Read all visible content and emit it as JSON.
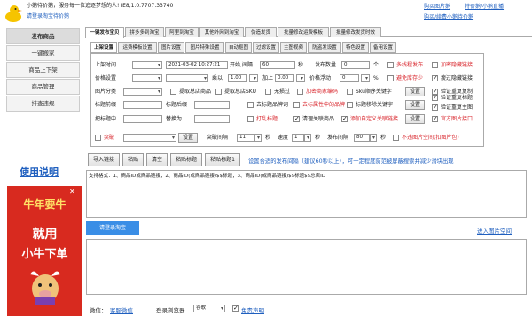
{
  "header": {
    "line1": "小鹅待价鹅，服务每一位追逐梦想的人! IE8,1.0.7707.33740",
    "login_link": "请登录淘宝待价鹅",
    "right_links": {
      "tutorial": "购买图片鹅",
      "get": "特价鹅/小鹅直播",
      "buy": "购买/续费小鹅待价鹅"
    }
  },
  "sidebar": {
    "items": [
      "发布商品",
      "一键搬家",
      "商品上下架",
      "商品管理",
      "排查违规"
    ],
    "help": "使用说明"
  },
  "tabs": [
    "一键发布宝贝",
    "拼多多到淘宝",
    "阿里到淘宝",
    "其他外网到淘宝",
    "伪造发货",
    "批量修改运费模板",
    "批量修改发货时效"
  ],
  "subtabs": [
    "上架设置",
    "运费模板设置",
    "图片设置",
    "图片特殊设置",
    "自动抠图",
    "过滤设置",
    "主图视频",
    "防盗发设置",
    "特色设置",
    "备用设置"
  ],
  "form": {
    "row1": {
      "label": "上架时间",
      "datetime": "2021-03-02 10:27:21",
      "interval_label": "开始,间隔",
      "interval": "60",
      "sec": "秒",
      "count_label": "发布数量",
      "count": "0",
      "unit": "个",
      "check1": "多线程发布",
      "check2": "加密隐藏链接"
    },
    "row2": {
      "label": "价格设置",
      "mult_label": "乘以",
      "mult": "1.00",
      "plus_label": "加上",
      "plus": "0.00",
      "float_label": "价格浮动",
      "float": "0",
      "pct": "%",
      "check1": "避免库存少"
    },
    "row3": {
      "label": "图片分类",
      "c1": "提取总店商品",
      "c2": "提取总店SKU",
      "c3": "无损过",
      "c4": "加密商家编码",
      "c5": "Sku顺序关键字",
      "set": "设置",
      "r1": "验证重复复制"
    },
    "row4": {
      "prefix": "标题前缀",
      "suffix": "标题后缀",
      "c1": "去标题品牌词",
      "c2": "去标属性中的品牌",
      "c3": "标题移除关键字",
      "set": "设置",
      "r1": "验证重复标题",
      "r2": "验证重复主图"
    },
    "row5": {
      "replace": "把标题中",
      "with": "替换为",
      "c1": "打乱标题",
      "c2": "清理关联商品",
      "c3": "添加自定义关联链接",
      "set": "设置",
      "r1": "官方图片接口"
    },
    "row6": {
      "c1": "突破",
      "set": "设置",
      "gap_label": "突破间隔",
      "gap": "11",
      "sec": "秒",
      "speed_label": "速度",
      "speed": "1",
      "sec2": "秒",
      "pub_label": "发布间隔",
      "pub": "80",
      "sec3": "秒",
      "c2": "不违图片空间(扣图片包)"
    },
    "right_extra": "瘦过隐藏链接"
  },
  "toolbar": {
    "buttons": [
      "导入链接",
      "粘贴",
      "清空",
      "粘贴标题",
      "粘贴标题1"
    ],
    "hint": "设置合适的发布间隔（建议60秒以上），可一定程度防范被屏蔽搜索并减少滑块出现"
  },
  "textarea": {
    "placeholder": "支持格式：1、商品ID或商品链接；2、商品ID(或商品链接)$$标题；3、商品ID(或商品链接)$$标题$$总店ID"
  },
  "login_button": "请登录淘宝",
  "image_space": "进入图片空间",
  "footer": {
    "wechat_label": "微信：",
    "wechat_link": "客服微信",
    "browser_label": "登录浏览器",
    "browser": "谷歌",
    "nopic": "免责声明"
  },
  "ad": {
    "line1": "牛年要牛",
    "line2": "就用",
    "line3": "小牛下单"
  },
  "colors": {
    "accent": "#1f5fbf",
    "red": "#d8232a",
    "button": "#3a8ee6"
  }
}
